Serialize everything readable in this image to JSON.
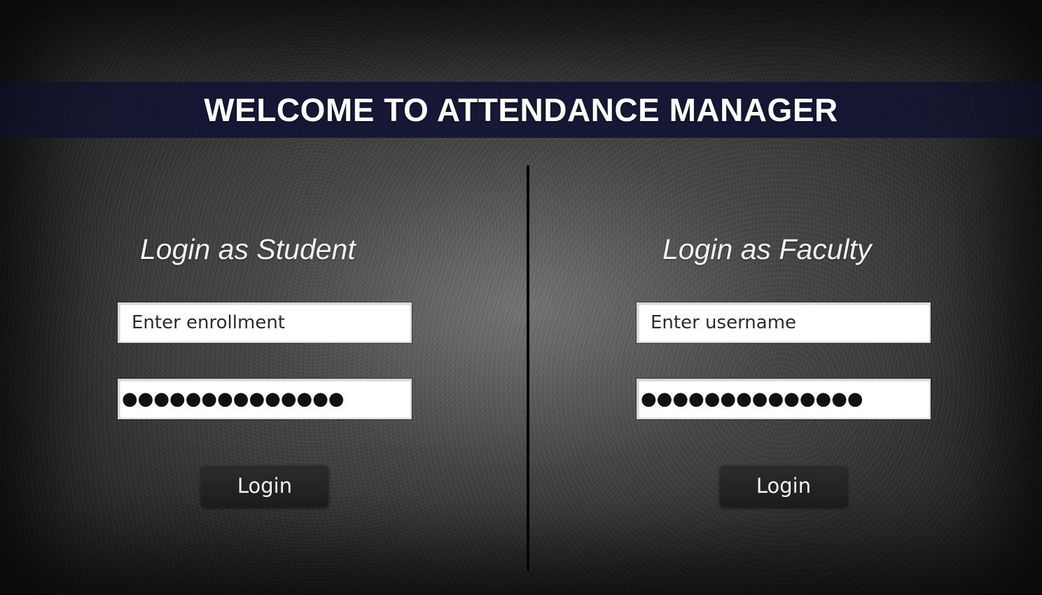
{
  "header": {
    "title": "WELCOME TO ATTENDANCE MANAGER"
  },
  "student": {
    "heading": "Login as Student",
    "enrollment_value": "Enter enrollment",
    "password_mask": "●●●●●●●●●●●●●●",
    "login_label": "Login"
  },
  "faculty": {
    "heading": "Login as Faculty",
    "username_value": "Enter username",
    "password_mask": "●●●●●●●●●●●●●●",
    "login_label": "Login"
  },
  "colors": {
    "title_band": "#12143a",
    "field_background": "#ffffff",
    "button_background": "#242424"
  }
}
